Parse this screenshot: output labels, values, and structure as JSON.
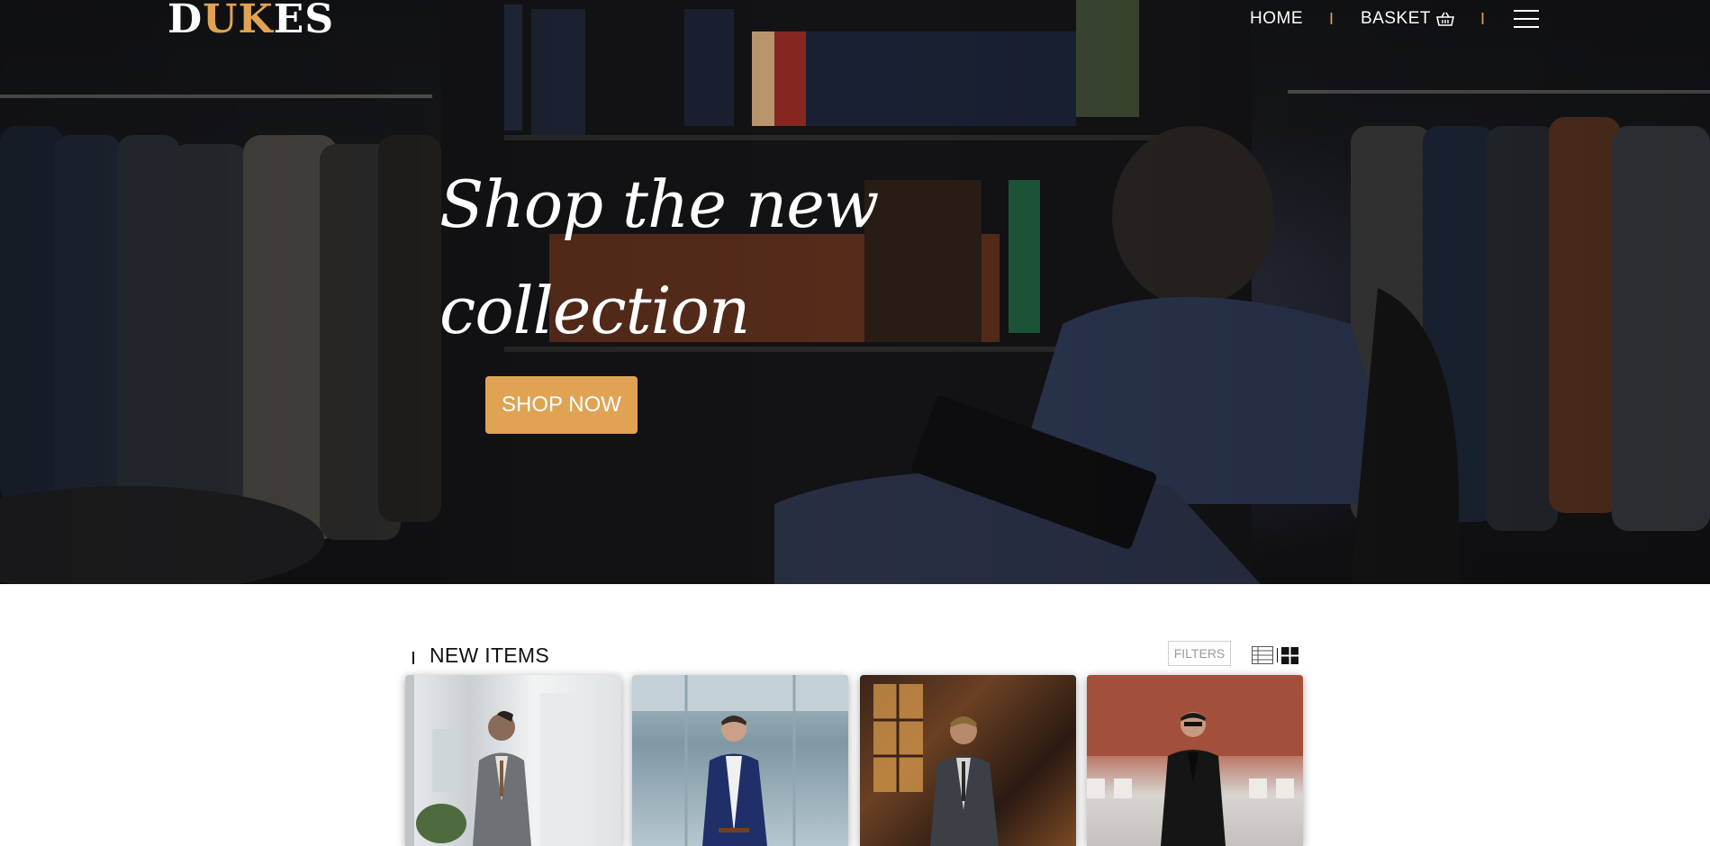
{
  "brand": {
    "logo_part1": "D",
    "logo_part2": "UK",
    "logo_part3": "ES",
    "accent": "#e0a353"
  },
  "nav": {
    "home": "HOME",
    "separator": "I",
    "basket": "BASKET",
    "basket_icon": "shopping-basket-icon",
    "menu_icon": "hamburger-menu-icon"
  },
  "hero": {
    "headline_line1": "Shop the new",
    "headline_line2": "collection",
    "cta": "SHOP NOW"
  },
  "section": {
    "title": "NEW ITEMS",
    "filters": "FILTERS",
    "view_icons": [
      "list-view-icon",
      "grid-view-icon"
    ]
  },
  "products": [
    {
      "image": "man-grey-check-suit-photo"
    },
    {
      "image": "man-navy-suit-photo"
    },
    {
      "image": "man-three-piece-suit-photo"
    },
    {
      "image": "man-black-suit-sunglasses-photo"
    }
  ]
}
